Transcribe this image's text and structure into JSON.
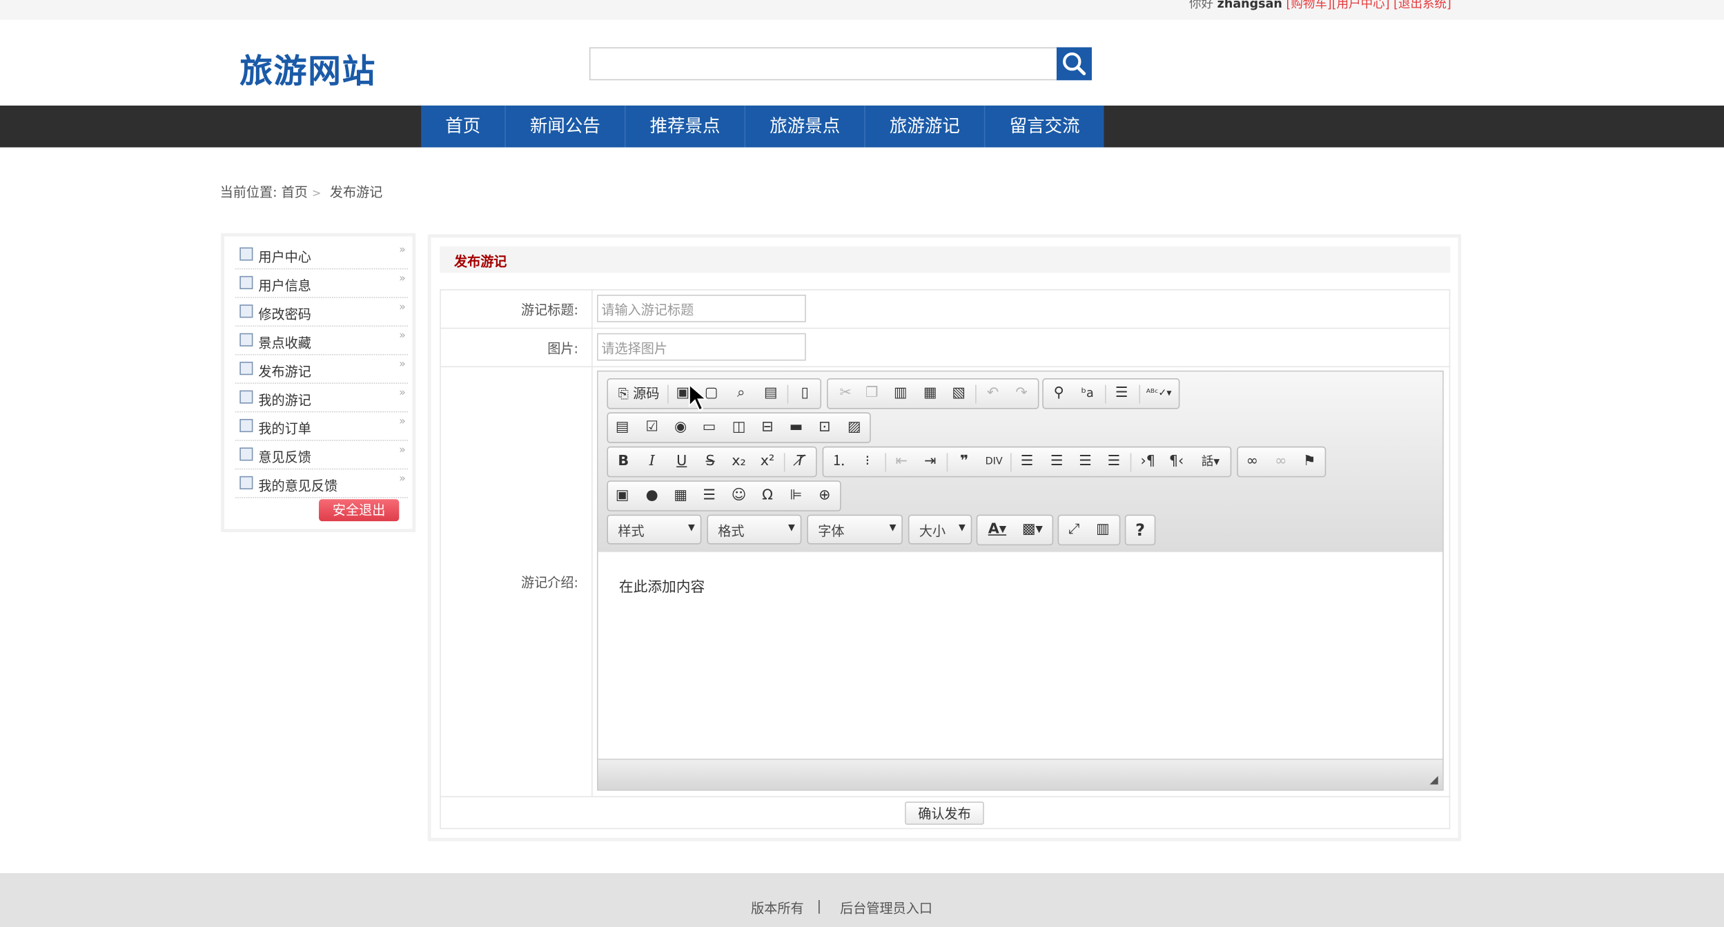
{
  "topbar": {
    "hello": "你好",
    "username": "zhangsan",
    "cart": "[购物车]",
    "usercenter": "[用户中心]",
    "logout": "[退出系统]"
  },
  "header": {
    "logo": "旅游网站",
    "search_placeholder": "",
    "search_icon": "search-icon"
  },
  "nav": {
    "items": [
      "首页",
      "新闻公告",
      "推荐景点",
      "旅游景点",
      "旅游游记",
      "留言交流"
    ]
  },
  "breadcrumb": {
    "prefix": "当前位置:",
    "home": "首页",
    "sep": ">",
    "current": "发布游记"
  },
  "sidebar": {
    "items": [
      "用户中心",
      "用户信息",
      "修改密码",
      "景点收藏",
      "发布游记",
      "我的游记",
      "我的订单",
      "意见反馈",
      "我的意见反馈"
    ],
    "arrow": "»",
    "logout": "安全退出"
  },
  "panel": {
    "title": "发布游记",
    "title_label": "游记标题:",
    "title_placeholder": "请输入游记标题",
    "image_label": "图片:",
    "image_placeholder": "请选择图片",
    "intro_label": "游记介绍:",
    "submit": "确认发布"
  },
  "editor": {
    "source_label": "源码",
    "combos": [
      "样式",
      "格式",
      "字体",
      "大小"
    ],
    "content": "在此添加内容",
    "row1_icons": [
      "save-icon",
      "new-page-icon",
      "preview-icon",
      "print-icon",
      "templates-icon",
      "cut-icon",
      "copy-icon",
      "paste-icon",
      "paste-text-icon",
      "paste-word-icon",
      "undo-icon",
      "redo-icon",
      "find-icon",
      "replace-icon",
      "select-all-icon",
      "spellcheck-icon"
    ],
    "row2_icons": [
      "form-icon",
      "checkbox-icon",
      "radio-icon",
      "textfield-icon",
      "textarea-icon",
      "select-icon",
      "button-icon",
      "image-button-icon",
      "hidden-field-icon"
    ],
    "row3_icons": [
      "bold-icon",
      "italic-icon",
      "underline-icon",
      "strike-icon",
      "subscript-icon",
      "superscript-icon",
      "remove-format-icon",
      "numbered-list-icon",
      "bulleted-list-icon",
      "outdent-icon",
      "indent-icon",
      "blockquote-icon",
      "div-icon",
      "align-left-icon",
      "align-center-icon",
      "align-right-icon",
      "justify-icon",
      "ltr-icon",
      "rtl-icon",
      "language-icon",
      "link-icon",
      "unlink-icon",
      "anchor-icon"
    ],
    "row4_icons": [
      "image-icon",
      "flash-icon",
      "table-icon",
      "horizontal-rule-icon",
      "smiley-icon",
      "special-char-icon",
      "page-break-icon",
      "iframe-icon"
    ],
    "row5_icons": [
      "text-color-icon",
      "bg-color-icon",
      "maximize-icon",
      "show-blocks-icon",
      "about-icon"
    ]
  },
  "footer": {
    "copyright": "版本所有",
    "divider": "|",
    "admin": "后台管理员入口"
  }
}
